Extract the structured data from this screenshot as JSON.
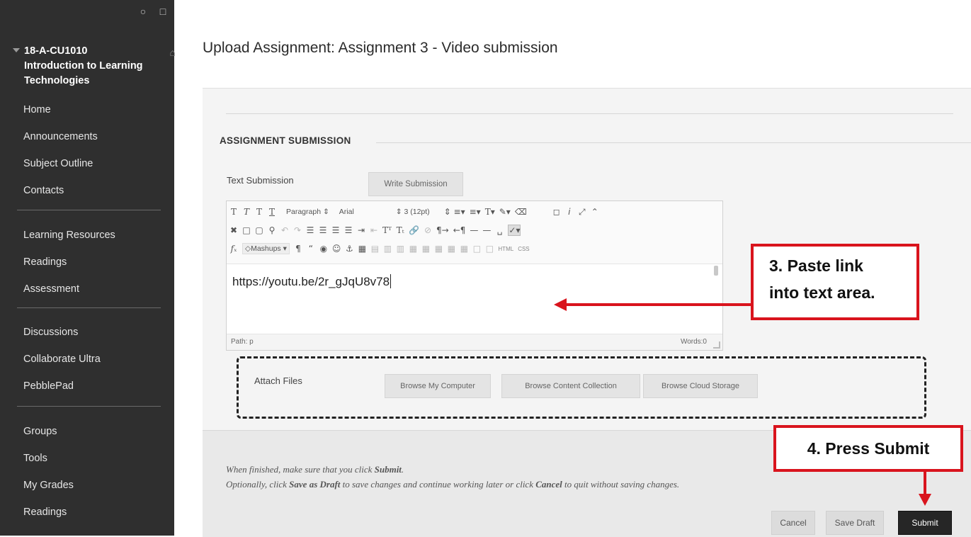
{
  "sidebar": {
    "course_title_lines": [
      "18-A-CU1010",
      "Introduction to Learning",
      "Technologies"
    ],
    "icons": [
      "refresh-icon",
      "folder-icon",
      "home-icon"
    ],
    "groups": [
      [
        "Home",
        "Announcements",
        "Subject Outline",
        "Contacts"
      ],
      [
        "Learning Resources",
        "Readings",
        "Assessment"
      ],
      [
        "Discussions",
        "Collaborate Ultra",
        "PebblePad"
      ],
      [
        "Groups",
        "Tools",
        "My Grades",
        "Readings"
      ]
    ]
  },
  "page": {
    "title": "Upload Assignment: Assignment 3 - Video submission",
    "section_heading": "ASSIGNMENT SUBMISSION",
    "text_submission_label": "Text Submission",
    "write_submission_button": "Write Submission"
  },
  "editor": {
    "paragraph_select": "Paragraph",
    "font_select": "Arial",
    "size_select": "3 (12pt)",
    "mashups_label": "Mashups",
    "html_label": "HTML",
    "css_label": "CSS",
    "content": "https://youtu.be/2r_gJqU8v78",
    "path_label": "Path: p",
    "words_label": "Words:0"
  },
  "attach": {
    "label": "Attach Files",
    "browse_computer": "Browse My Computer",
    "browse_content": "Browse Content Collection",
    "browse_cloud": "Browse Cloud Storage"
  },
  "submit_bar": {
    "line1_prefix": "When finished, make sure that you click ",
    "line1_bold": "Submit",
    "line1_suffix": ".",
    "line2_prefix": "Optionally, click ",
    "line2_bold1": "Save as Draft",
    "line2_mid": " to save changes and continue working later or click ",
    "line2_bold2": "Cancel",
    "line2_suffix": " to quit without saving changes.",
    "cancel": "Cancel",
    "save_draft": "Save Draft",
    "submit": "Submit"
  },
  "annotations": {
    "step3_line1": "3. Paste link",
    "step3_line2": "into text area.",
    "step4": "4. Press Submit",
    "color": "#d9141d"
  }
}
